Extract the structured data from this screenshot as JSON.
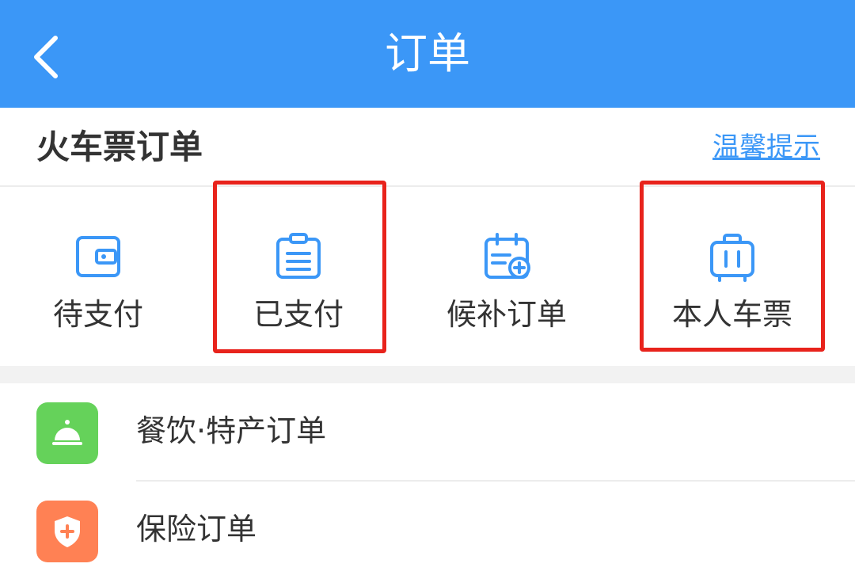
{
  "nav": {
    "title": "订单",
    "back_icon": "chevron-left-icon",
    "background": "#3b97f7"
  },
  "section": {
    "title": "火车票订单",
    "tips_link": "温馨提示"
  },
  "quick_actions": [
    {
      "label": "待支付",
      "icon": "wallet-icon",
      "highlighted": false
    },
    {
      "label": "已支付",
      "icon": "clipboard-icon",
      "highlighted": true
    },
    {
      "label": "候补订单",
      "icon": "calendar-add-icon",
      "highlighted": false
    },
    {
      "label": "本人车票",
      "icon": "suitcase-icon",
      "highlighted": true
    }
  ],
  "list": [
    {
      "label": "餐饮·特产订单",
      "icon": "service-bell-icon",
      "color": "#65d25a"
    },
    {
      "label": "保险订单",
      "icon": "shield-plus-icon",
      "color": "#ff8154"
    }
  ],
  "colors": {
    "accent": "#3b97f7",
    "highlight": "#e8231c"
  }
}
